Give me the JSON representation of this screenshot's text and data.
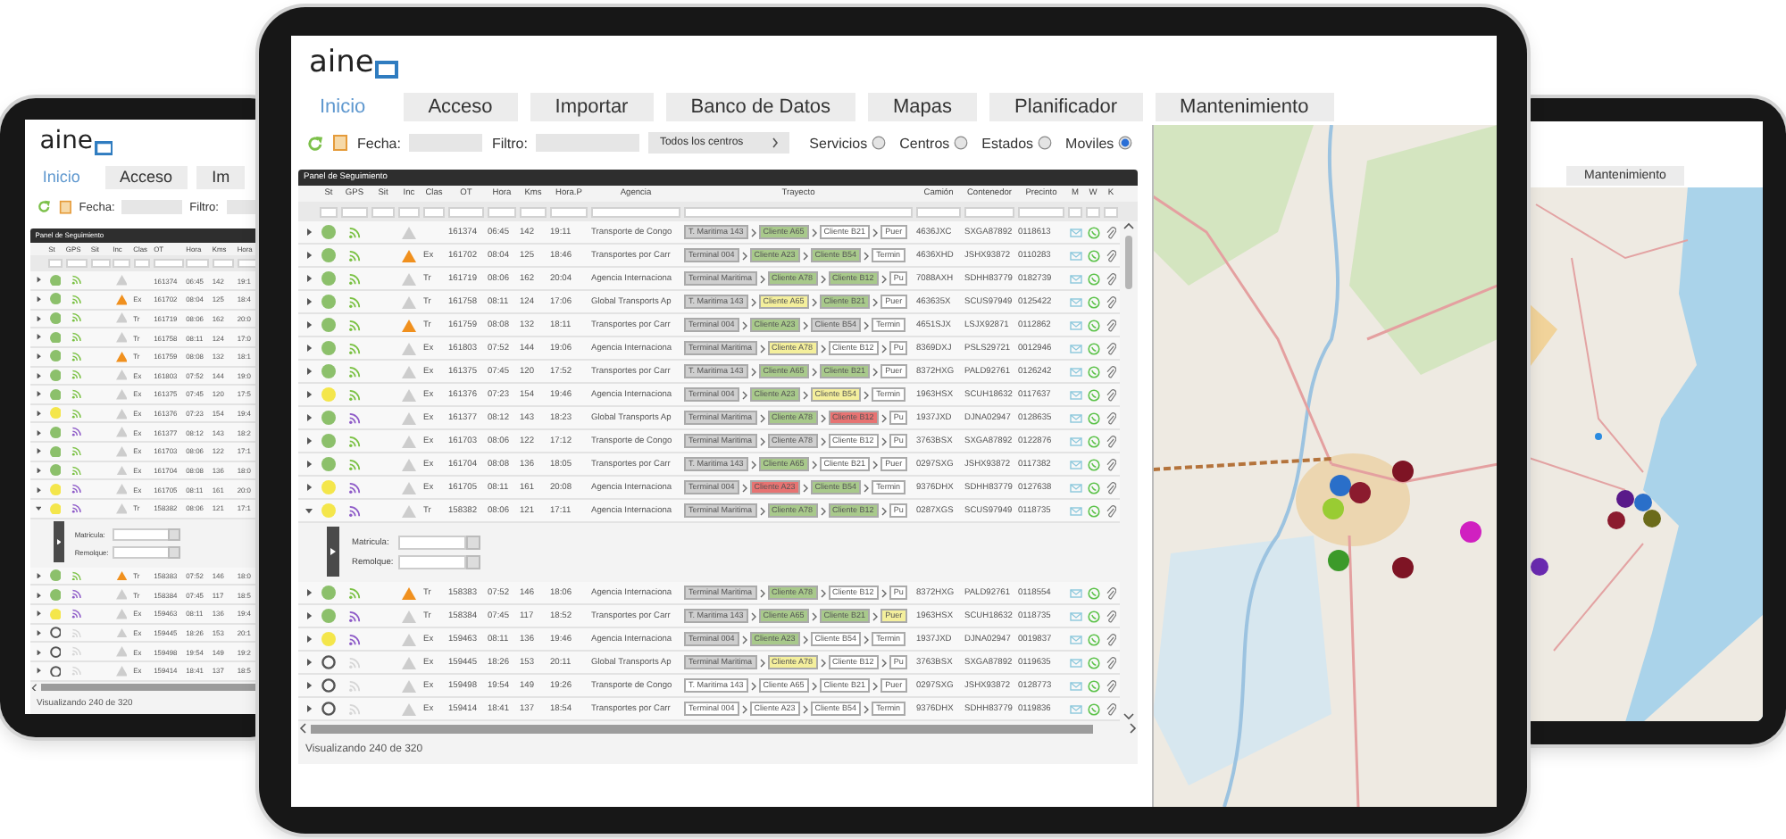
{
  "left_tablet": {
    "logo": "aine",
    "tabs": [
      {
        "label": "Inicio",
        "selected": true
      },
      {
        "label": "Acceso",
        "selected": false
      },
      {
        "label": "Im",
        "selected": false
      }
    ],
    "toolbar": {
      "date_label": "Fecha:",
      "filter_label": "Filtro:"
    },
    "panel": {
      "title": "Panel de Seguimiento",
      "columns": [
        "St",
        "GPS",
        "Sit",
        "Inc",
        "Clas",
        "OT",
        "Hora",
        "Kms",
        "Hora"
      ],
      "rows": [
        {
          "expanded": false,
          "status": {
            "color": "#8cc06b"
          },
          "gps": {
            "color": "#7ac143"
          },
          "incident": false,
          "ot": "161374",
          "hora": "06:45",
          "kms": "142",
          "hora_p": "19:1"
        },
        {
          "expanded": false,
          "status": {
            "color": "#8cc06b"
          },
          "gps": {
            "color": "#7ac143"
          },
          "incident": true,
          "clas": "Ex",
          "ot": "161702",
          "hora": "08:04",
          "kms": "125",
          "hora_p": "18:4"
        },
        {
          "expanded": false,
          "status": {
            "color": "#8cc06b"
          },
          "gps": {
            "color": "#7ac143"
          },
          "incident": false,
          "clas": "Tr",
          "ot": "161719",
          "hora": "08:06",
          "kms": "162",
          "hora_p": "20:0"
        },
        {
          "expanded": false,
          "status": {
            "color": "#8cc06b"
          },
          "gps": {
            "color": "#7ac143"
          },
          "incident": false,
          "clas": "Tr",
          "ot": "161758",
          "hora": "08:11",
          "kms": "124",
          "hora_p": "17:0"
        },
        {
          "expanded": false,
          "status": {
            "color": "#8cc06b"
          },
          "gps": {
            "color": "#7ac143"
          },
          "incident": true,
          "clas": "Tr",
          "ot": "161759",
          "hora": "08:08",
          "kms": "132",
          "hora_p": "18:1"
        },
        {
          "expanded": false,
          "status": {
            "color": "#8cc06b"
          },
          "gps": {
            "color": "#7ac143"
          },
          "incident": false,
          "clas": "Ex",
          "ot": "161803",
          "hora": "07:52",
          "kms": "144",
          "hora_p": "19:0"
        },
        {
          "expanded": false,
          "status": {
            "color": "#8cc06b"
          },
          "gps": {
            "color": "#7ac143"
          },
          "incident": false,
          "clas": "Ex",
          "ot": "161375",
          "hora": "07:45",
          "kms": "120",
          "hora_p": "17:5"
        },
        {
          "expanded": false,
          "status": {
            "color": "#f4e64b"
          },
          "gps": {
            "color": "#7ac143"
          },
          "incident": false,
          "clas": "Ex",
          "ot": "161376",
          "hora": "07:23",
          "kms": "154",
          "hora_p": "19:4"
        },
        {
          "expanded": false,
          "status": {
            "color": "#8cc06b"
          },
          "gps": {
            "color": "#8e5bc8"
          },
          "incident": false,
          "clas": "Ex",
          "ot": "161377",
          "hora": "08:12",
          "kms": "143",
          "hora_p": "18:2"
        },
        {
          "expanded": false,
          "status": {
            "color": "#8cc06b"
          },
          "gps": {
            "color": "#7ac143"
          },
          "incident": false,
          "clas": "Ex",
          "ot": "161703",
          "hora": "08:06",
          "kms": "122",
          "hora_p": "17:1"
        },
        {
          "expanded": false,
          "status": {
            "color": "#8cc06b"
          },
          "gps": {
            "color": "#7ac143"
          },
          "incident": false,
          "clas": "Ex",
          "ot": "161704",
          "hora": "08:08",
          "kms": "136",
          "hora_p": "18:0"
        },
        {
          "expanded": false,
          "status": {
            "color": "#f4e64b"
          },
          "gps": {
            "color": "#8e5bc8"
          },
          "incident": false,
          "clas": "Ex",
          "ot": "161705",
          "hora": "08:11",
          "kms": "161",
          "hora_p": "20:0"
        },
        {
          "expanded": true,
          "status": {
            "color": "#f4e64b"
          },
          "gps": {
            "color": "#8e5bc8"
          },
          "incident": false,
          "clas": "Tr",
          "ot": "158382",
          "hora": "08:06",
          "kms": "121",
          "hora_p": "17:1",
          "details": [
            {
              "label": "Matricula:"
            },
            {
              "label": "Remolque:"
            }
          ]
        },
        {
          "expanded": false,
          "status": {
            "color": "#8cc06b"
          },
          "gps": {
            "color": "#7ac143"
          },
          "incident": true,
          "clas": "Tr",
          "ot": "158383",
          "hora": "07:52",
          "kms": "146",
          "hora_p": "18:0"
        },
        {
          "expanded": false,
          "status": {
            "color": "#8cc06b"
          },
          "gps": {
            "color": "#8e5bc8"
          },
          "incident": false,
          "clas": "Tr",
          "ot": "158384",
          "hora": "07:45",
          "kms": "117",
          "hora_p": "18:5"
        },
        {
          "expanded": false,
          "status": {
            "color": "#f4e64b"
          },
          "gps": {
            "color": "#8e5bc8"
          },
          "incident": false,
          "clas": "Ex",
          "ot": "159463",
          "hora": "08:11",
          "kms": "136",
          "hora_p": "19:4"
        },
        {
          "expanded": false,
          "gps": {
            "color": "#d6d6d6"
          },
          "incident": false,
          "clas": "Ex",
          "ot": "159445",
          "hora": "18:26",
          "kms": "153",
          "hora_p": "20:1"
        },
        {
          "expanded": false,
          "gps": {
            "color": "#d6d6d6"
          },
          "incident": false,
          "clas": "Ex",
          "ot": "159498",
          "hora": "19:54",
          "kms": "149",
          "hora_p": "19:2"
        },
        {
          "expanded": false,
          "gps": {
            "color": "#d6d6d6"
          },
          "incident": false,
          "clas": "Ex",
          "ot": "159414",
          "hora": "18:41",
          "kms": "137",
          "hora_p": "18:5"
        }
      ],
      "footer": "Visualizando 240 de 320"
    }
  },
  "main_tablet": {
    "logo": "aine",
    "tabs": [
      {
        "label": "Inicio",
        "selected": true
      },
      {
        "label": "Acceso",
        "selected": false
      },
      {
        "label": "Importar",
        "selected": false
      },
      {
        "label": "Banco de Datos",
        "selected": false
      },
      {
        "label": "Mapas",
        "selected": false
      },
      {
        "label": "Planificador",
        "selected": false
      },
      {
        "label": "Mantenimiento",
        "selected": false
      }
    ],
    "toolbar": {
      "date_label": "Fecha:",
      "filter_label": "Filtro:",
      "centers_button": "Todos los centros",
      "radios": [
        {
          "label": "Servicios",
          "selected": false
        },
        {
          "label": "Centros",
          "selected": false
        },
        {
          "label": "Estados",
          "selected": false
        },
        {
          "label": "Moviles",
          "selected": true
        }
      ]
    },
    "panel": {
      "title": "Panel de Seguimiento",
      "columns": [
        "St",
        "GPS",
        "Sit",
        "Inc",
        "Clas",
        "OT",
        "Hora",
        "Kms",
        "Hora.P",
        "Agencia",
        "Trayecto",
        "Camión",
        "Contenedor",
        "Precinto",
        "M",
        "W",
        "K"
      ],
      "rows": [
        {
          "expanded": false,
          "status": {
            "color": "#8cc06b"
          },
          "gps": {
            "color": "#7ac143"
          },
          "incident": false,
          "ot": "161374",
          "hora": "06:45",
          "kms": "142",
          "hora_p": "19:11",
          "agencia": "Transporte de Congo",
          "trayecto": [
            {
              "label": "T. Maritima 143",
              "color": "#cfcfcf"
            },
            {
              "label": "Cliente A65",
              "color": "#a8c98b"
            },
            {
              "label": "Cliente B21",
              "color": "#ffffff"
            },
            {
              "label": "Puer",
              "color": "#ffffff"
            }
          ],
          "camion": "4636JXC",
          "contenedor": "SXGA87892",
          "precinto": "0118613"
        },
        {
          "expanded": false,
          "status": {
            "color": "#8cc06b"
          },
          "gps": {
            "color": "#7ac143"
          },
          "incident": true,
          "clas": "Ex",
          "ot": "161702",
          "hora": "08:04",
          "kms": "125",
          "hora_p": "18:46",
          "agencia": "Transportes por Carr",
          "trayecto": [
            {
              "label": "Terminal 004",
              "color": "#cfcfcf"
            },
            {
              "label": "Cliente A23",
              "color": "#a8c98b"
            },
            {
              "label": "Cliente B54",
              "color": "#a8c98b"
            },
            {
              "label": "Termin",
              "color": "#ffffff"
            }
          ],
          "camion": "4636XHD",
          "contenedor": "JSHX93872",
          "precinto": "0110283"
        },
        {
          "expanded": false,
          "status": {
            "color": "#8cc06b"
          },
          "gps": {
            "color": "#7ac143"
          },
          "incident": false,
          "clas": "Tr",
          "ot": "161719",
          "hora": "08:06",
          "kms": "162",
          "hora_p": "20:04",
          "agencia": "Agencia Internaciona",
          "trayecto": [
            {
              "label": "Terminal Maritima",
              "color": "#cfcfcf"
            },
            {
              "label": "Cliente A78",
              "color": "#a8c98b"
            },
            {
              "label": "Cliente B12",
              "color": "#a8c98b"
            },
            {
              "label": "Pu",
              "color": "#ffffff"
            }
          ],
          "camion": "7088AXH",
          "contenedor": "SDHH83779",
          "precinto": "0182739"
        },
        {
          "expanded": false,
          "status": {
            "color": "#8cc06b"
          },
          "gps": {
            "color": "#7ac143"
          },
          "incident": false,
          "clas": "Tr",
          "ot": "161758",
          "hora": "08:11",
          "kms": "124",
          "hora_p": "17:06",
          "agencia": "Global Transports Ap",
          "trayecto": [
            {
              "label": "T. Maritima 143",
              "color": "#cfcfcf"
            },
            {
              "label": "Cliente A65",
              "color": "#f4ef9c"
            },
            {
              "label": "Cliente B21",
              "color": "#a8c98b"
            },
            {
              "label": "Puer",
              "color": "#ffffff"
            }
          ],
          "camion": "463635X",
          "contenedor": "SCUS97949",
          "precinto": "0125422"
        },
        {
          "expanded": false,
          "status": {
            "color": "#8cc06b"
          },
          "gps": {
            "color": "#7ac143"
          },
          "incident": true,
          "clas": "Tr",
          "ot": "161759",
          "hora": "08:08",
          "kms": "132",
          "hora_p": "18:11",
          "agencia": "Transportes por Carr",
          "trayecto": [
            {
              "label": "Terminal 004",
              "color": "#cfcfcf"
            },
            {
              "label": "Cliente A23",
              "color": "#a8c98b"
            },
            {
              "label": "Cliente B54",
              "color": "#cfcfcf"
            },
            {
              "label": "Termin",
              "color": "#ffffff"
            }
          ],
          "camion": "4651SJX",
          "contenedor": "LSJX92871",
          "precinto": "0112862"
        },
        {
          "expanded": false,
          "status": {
            "color": "#8cc06b"
          },
          "gps": {
            "color": "#7ac143"
          },
          "incident": false,
          "clas": "Ex",
          "ot": "161803",
          "hora": "07:52",
          "kms": "144",
          "hora_p": "19:06",
          "agencia": "Agencia Internaciona",
          "trayecto": [
            {
              "label": "Terminal Maritima",
              "color": "#cfcfcf"
            },
            {
              "label": "Cliente A78",
              "color": "#f4ef9c"
            },
            {
              "label": "Cliente B12",
              "color": "#ffffff"
            },
            {
              "label": "Pu",
              "color": "#ffffff"
            }
          ],
          "camion": "8369DXJ",
          "contenedor": "PSLS29721",
          "precinto": "0012946"
        },
        {
          "expanded": false,
          "status": {
            "color": "#8cc06b"
          },
          "gps": {
            "color": "#7ac143"
          },
          "incident": false,
          "clas": "Ex",
          "ot": "161375",
          "hora": "07:45",
          "kms": "120",
          "hora_p": "17:52",
          "agencia": "Transportes por Carr",
          "trayecto": [
            {
              "label": "T. Maritima 143",
              "color": "#cfcfcf"
            },
            {
              "label": "Cliente A65",
              "color": "#a8c98b"
            },
            {
              "label": "Cliente B21",
              "color": "#a8c98b"
            },
            {
              "label": "Puer",
              "color": "#ffffff"
            }
          ],
          "camion": "8372HXG",
          "contenedor": "PALD92761",
          "precinto": "0126242"
        },
        {
          "expanded": false,
          "status": {
            "color": "#f4e64b"
          },
          "gps": {
            "color": "#7ac143"
          },
          "incident": false,
          "clas": "Ex",
          "ot": "161376",
          "hora": "07:23",
          "kms": "154",
          "hora_p": "19:46",
          "agencia": "Agencia Internaciona",
          "trayecto": [
            {
              "label": "Terminal 004",
              "color": "#cfcfcf"
            },
            {
              "label": "Cliente A23",
              "color": "#a8c98b"
            },
            {
              "label": "Cliente B54",
              "color": "#f4ef9c"
            },
            {
              "label": "Termin",
              "color": "#ffffff"
            }
          ],
          "camion": "1963HSX",
          "contenedor": "SCUH18632",
          "precinto": "0117637"
        },
        {
          "expanded": false,
          "status": {
            "color": "#8cc06b"
          },
          "gps": {
            "color": "#8e5bc8"
          },
          "incident": false,
          "clas": "Ex",
          "ot": "161377",
          "hora": "08:12",
          "kms": "143",
          "hora_p": "18:23",
          "agencia": "Global Transports Ap",
          "trayecto": [
            {
              "label": "Terminal Maritima",
              "color": "#cfcfcf"
            },
            {
              "label": "Cliente A78",
              "color": "#a8c98b"
            },
            {
              "label": "Cliente B12",
              "color": "#e77372"
            },
            {
              "label": "Pu",
              "color": "#ffffff"
            }
          ],
          "camion": "1937JXD",
          "contenedor": "DJNA02947",
          "precinto": "0128635"
        },
        {
          "expanded": false,
          "status": {
            "color": "#8cc06b"
          },
          "gps": {
            "color": "#7ac143"
          },
          "incident": false,
          "clas": "Ex",
          "ot": "161703",
          "hora": "08:06",
          "kms": "122",
          "hora_p": "17:12",
          "agencia": "Transporte de Congo",
          "trayecto": [
            {
              "label": "Terminal Maritima",
              "color": "#cfcfcf"
            },
            {
              "label": "Cliente A78",
              "color": "#cfcfcf"
            },
            {
              "label": "Cliente B12",
              "color": "#ffffff"
            },
            {
              "label": "Pu",
              "color": "#ffffff"
            }
          ],
          "camion": "3763BSX",
          "contenedor": "SXGA87892",
          "precinto": "0122876"
        },
        {
          "expanded": false,
          "status": {
            "color": "#8cc06b"
          },
          "gps": {
            "color": "#7ac143"
          },
          "incident": false,
          "clas": "Ex",
          "ot": "161704",
          "hora": "08:08",
          "kms": "136",
          "hora_p": "18:05",
          "agencia": "Transportes por Carr",
          "trayecto": [
            {
              "label": "T. Maritima 143",
              "color": "#cfcfcf"
            },
            {
              "label": "Cliente A65",
              "color": "#a8c98b"
            },
            {
              "label": "Cliente B21",
              "color": "#ffffff"
            },
            {
              "label": "Puer",
              "color": "#ffffff"
            }
          ],
          "camion": "0297SXG",
          "contenedor": "JSHX93872",
          "precinto": "0117382"
        },
        {
          "expanded": false,
          "status": {
            "color": "#f4e64b"
          },
          "gps": {
            "color": "#8e5bc8"
          },
          "incident": false,
          "clas": "Ex",
          "ot": "161705",
          "hora": "08:11",
          "kms": "161",
          "hora_p": "20:08",
          "agencia": "Agencia Internaciona",
          "trayecto": [
            {
              "label": "Terminal 004",
              "color": "#cfcfcf"
            },
            {
              "label": "Cliente A23",
              "color": "#e77372"
            },
            {
              "label": "Cliente B54",
              "color": "#a8c98b"
            },
            {
              "label": "Termin",
              "color": "#ffffff"
            }
          ],
          "camion": "9376DHX",
          "contenedor": "SDHH83779",
          "precinto": "0127638"
        },
        {
          "expanded": true,
          "status": {
            "color": "#f4e64b"
          },
          "gps": {
            "color": "#8e5bc8"
          },
          "incident": false,
          "clas": "Tr",
          "ot": "158382",
          "hora": "08:06",
          "kms": "121",
          "hora_p": "17:11",
          "agencia": "Agencia Internaciona",
          "trayecto": [
            {
              "label": "Terminal Maritima",
              "color": "#cfcfcf"
            },
            {
              "label": "Cliente A78",
              "color": "#a8c98b"
            },
            {
              "label": "Cliente B12",
              "color": "#a8c98b"
            },
            {
              "label": "Pu",
              "color": "#ffffff"
            }
          ],
          "camion": "0287XGS",
          "contenedor": "SCUS97949",
          "precinto": "0118735",
          "details": [
            {
              "label": "Matricula:"
            },
            {
              "label": "Remolque:"
            }
          ]
        },
        {
          "expanded": false,
          "status": {
            "color": "#8cc06b"
          },
          "gps": {
            "color": "#7ac143"
          },
          "incident": true,
          "clas": "Tr",
          "ot": "158383",
          "hora": "07:52",
          "kms": "146",
          "hora_p": "18:06",
          "agencia": "Agencia Internaciona",
          "trayecto": [
            {
              "label": "Terminal Maritima",
              "color": "#cfcfcf"
            },
            {
              "label": "Cliente A78",
              "color": "#a8c98b"
            },
            {
              "label": "Cliente B12",
              "color": "#ffffff"
            },
            {
              "label": "Pu",
              "color": "#ffffff"
            }
          ],
          "camion": "8372HXG",
          "contenedor": "PALD92761",
          "precinto": "0118554"
        },
        {
          "expanded": false,
          "status": {
            "color": "#8cc06b"
          },
          "gps": {
            "color": "#8e5bc8"
          },
          "incident": false,
          "clas": "Tr",
          "ot": "158384",
          "hora": "07:45",
          "kms": "117",
          "hora_p": "18:52",
          "agencia": "Transportes por Carr",
          "trayecto": [
            {
              "label": "T. Maritima 143",
              "color": "#cfcfcf"
            },
            {
              "label": "Cliente A65",
              "color": "#a8c98b"
            },
            {
              "label": "Cliente B21",
              "color": "#a8c98b"
            },
            {
              "label": "Puer",
              "color": "#f4ef9c"
            }
          ],
          "camion": "1963HSX",
          "contenedor": "SCUH18632",
          "precinto": "0118735"
        },
        {
          "expanded": false,
          "status": {
            "color": "#f4e64b"
          },
          "gps": {
            "color": "#8e5bc8"
          },
          "incident": false,
          "clas": "Ex",
          "ot": "159463",
          "hora": "08:11",
          "kms": "136",
          "hora_p": "19:46",
          "agencia": "Agencia Internaciona",
          "trayecto": [
            {
              "label": "Terminal 004",
              "color": "#cfcfcf"
            },
            {
              "label": "Cliente A23",
              "color": "#a8c98b"
            },
            {
              "label": "Cliente B54",
              "color": "#ffffff"
            },
            {
              "label": "Termin",
              "color": "#ffffff"
            }
          ],
          "camion": "1937JXD",
          "contenedor": "DJNA02947",
          "precinto": "0019837"
        },
        {
          "expanded": false,
          "gps": {
            "color": "#d6d6d6"
          },
          "incident": false,
          "clas": "Ex",
          "ot": "159445",
          "hora": "18:26",
          "kms": "153",
          "hora_p": "20:11",
          "agencia": "Global Transports Ap",
          "trayecto": [
            {
              "label": "Terminal Maritima",
              "color": "#cfcfcf"
            },
            {
              "label": "Cliente A78",
              "color": "#f4ef9c"
            },
            {
              "label": "Cliente B12",
              "color": "#ffffff"
            },
            {
              "label": "Pu",
              "color": "#ffffff"
            }
          ],
          "camion": "3763BSX",
          "contenedor": "SXGA87892",
          "precinto": "0119635"
        },
        {
          "expanded": false,
          "gps": {
            "color": "#d6d6d6"
          },
          "incident": false,
          "clas": "Ex",
          "ot": "159498",
          "hora": "19:54",
          "kms": "149",
          "hora_p": "19:26",
          "agencia": "Transporte de Congo",
          "trayecto": [
            {
              "label": "T. Maritima 143",
              "color": "#ffffff"
            },
            {
              "label": "Cliente A65",
              "color": "#ffffff"
            },
            {
              "label": "Cliente B21",
              "color": "#ffffff"
            },
            {
              "label": "Puer",
              "color": "#ffffff"
            }
          ],
          "camion": "0297SXG",
          "contenedor": "JSHX93872",
          "precinto": "0128773"
        },
        {
          "expanded": false,
          "gps": {
            "color": "#d6d6d6"
          },
          "incident": false,
          "clas": "Ex",
          "ot": "159414",
          "hora": "18:41",
          "kms": "137",
          "hora_p": "18:54",
          "agencia": "Transportes por Carr",
          "trayecto": [
            {
              "label": "Terminal 004",
              "color": "#ffffff"
            },
            {
              "label": "Cliente A23",
              "color": "#ffffff"
            },
            {
              "label": "Cliente B54",
              "color": "#ffffff"
            },
            {
              "label": "Termin",
              "color": "#ffffff"
            }
          ],
          "camion": "9376DHX",
          "contenedor": "SDHH83779",
          "precinto": "0119836"
        }
      ],
      "footer": "Visualizando 240 de 320"
    }
  },
  "right_tablet": {
    "tabs": [
      {
        "label": "Mantenimiento",
        "selected": false
      }
    ]
  }
}
